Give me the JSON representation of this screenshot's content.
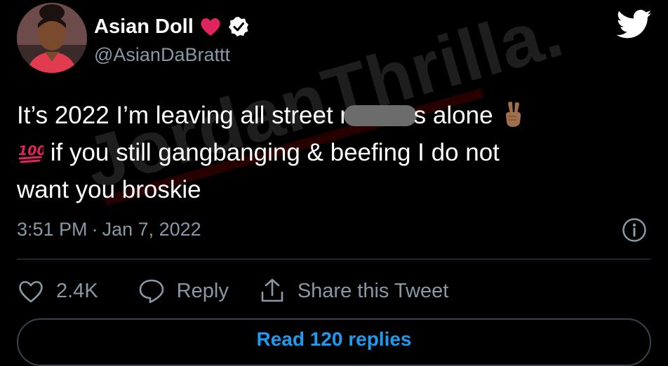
{
  "user": {
    "display_name": "Asian Doll",
    "handle": "@AsianDaBrattt",
    "name_emoji_icon": "red-heart-icon",
    "verified_icon": "verified-badge-icon"
  },
  "watermark": {
    "text": "JordanThrilla."
  },
  "tweet": {
    "line1_before": "It’s 2022 I’m leaving all street ni",
    "line1_after": "s alone",
    "line1_emoji_icon": "victory-hand-icon",
    "line2_emoji_icon": "hundred-points-icon",
    "line2_text": " if you still gangbanging & beefing I do not",
    "line3_text": "want you broskie",
    "time": "3:51 PM",
    "separator": "·",
    "date": "Jan 7, 2022"
  },
  "actions": {
    "like_count": "2.4K",
    "reply_label": "Reply",
    "share_label": "Share this Tweet"
  },
  "footer": {
    "read_replies_label": "Read 120 replies"
  },
  "colors": {
    "background": "#000000",
    "primary_text": "#ffffff",
    "secondary_text": "#8899a6",
    "accent_blue": "#1d9bf0",
    "heart_red": "#e0245e",
    "divider": "#38444d"
  }
}
